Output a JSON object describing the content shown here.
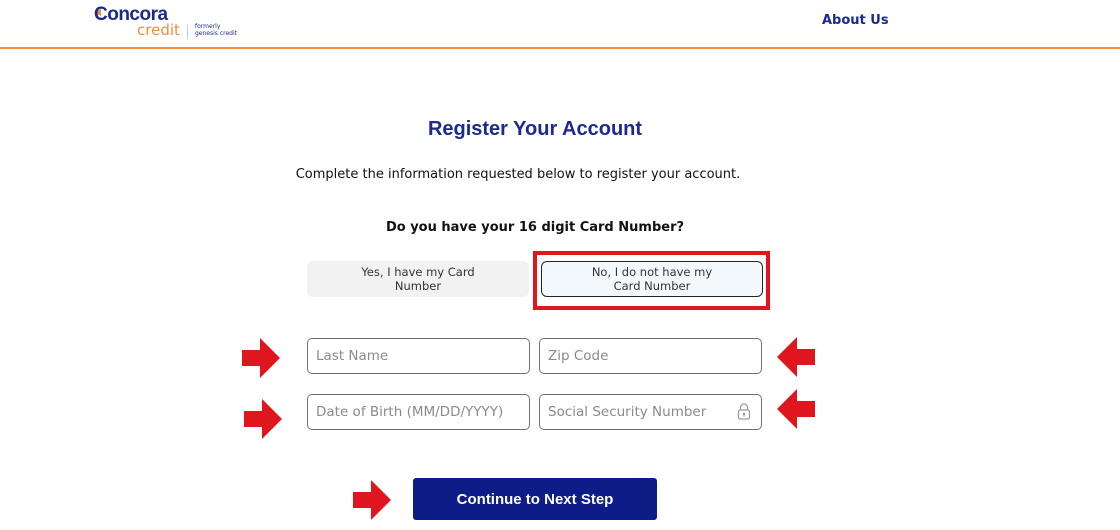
{
  "header": {
    "logo": {
      "brand": "Concora",
      "sub": "credit",
      "formerly": "formerly",
      "formerly_name": "genesis credit"
    },
    "nav": {
      "about_us": "About Us"
    }
  },
  "main": {
    "title": "Register Your Account",
    "subtitle": "Complete the information requested below to register your account.",
    "question": "Do you have your 16 digit Card Number?",
    "options": {
      "yes_label": "Yes, I have my Card Number",
      "no_label": "No, I do not have my Card Number",
      "selected": "no"
    },
    "fields": {
      "last_name_placeholder": "Last Name",
      "zip_placeholder": "Zip Code",
      "dob_placeholder": "Date of Birth (MM/DD/YYYY)",
      "ssn_placeholder": "Social Security Number"
    },
    "continue_label": "Continue to Next Step"
  },
  "colors": {
    "brand_navy": "#1b2a8c",
    "brand_orange": "#e8913a",
    "button_navy": "#0d1c87",
    "annotation_red": "#e0161f"
  },
  "icons": {
    "lock": "lock-icon",
    "annotation_arrow": "arrow-icon"
  }
}
